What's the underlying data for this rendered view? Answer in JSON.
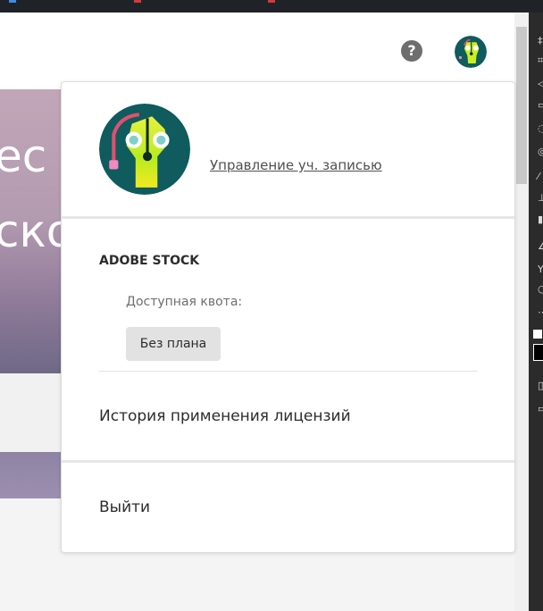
{
  "header": {
    "help_glyph": "?",
    "help_icon": "help-circle-icon"
  },
  "hero": {
    "line1": "ес",
    "line2": "ско"
  },
  "account_menu": {
    "manage_account": "Управление уч. записью",
    "section_title": "ADOBE STOCK",
    "quota_label": "Доступная квота:",
    "plan": "Без плана",
    "license_history": "История применения лицензий",
    "sign_out": "Выйти"
  },
  "colors": {
    "avatar_background": "#0f5b5e",
    "avatar_figure": "#c8f020",
    "avatar_arc": "#e0506e",
    "text_primary": "#2c2c2c",
    "text_secondary": "#6e6e6e",
    "badge_background": "#e2e2e2"
  }
}
